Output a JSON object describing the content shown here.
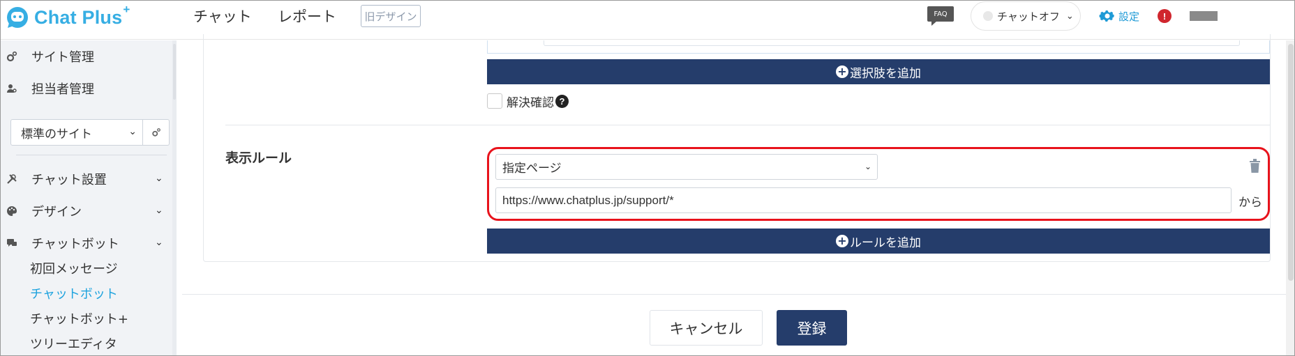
{
  "header": {
    "logo_text": "Chat Plus",
    "logo_plus": "+",
    "nav": {
      "chat": "チャット",
      "report": "レポート"
    },
    "old_design": "旧デザイン",
    "faq": "FAQ",
    "chat_status": "チャットオフ",
    "settings": "設定",
    "alert": "!"
  },
  "sidebar": {
    "items_top": [
      {
        "label": "サイト管理",
        "icon": "gears-icon"
      },
      {
        "label": "担当者管理",
        "icon": "users-icon"
      }
    ],
    "site_select": "標準のサイト",
    "items": [
      {
        "label": "チャット設置",
        "icon": "tools-icon"
      },
      {
        "label": "デザイン",
        "icon": "palette-icon"
      },
      {
        "label": "チャットボット",
        "icon": "chat-bubbles-icon"
      }
    ],
    "sub_items": [
      {
        "label": "初回メッセージ"
      },
      {
        "label": "チャットボット"
      },
      {
        "label": "チャットボット+"
      },
      {
        "label": "ツリーエディタ"
      }
    ]
  },
  "main": {
    "add_choice_button": "選択肢を追加",
    "resolve_check_label": "解決確認",
    "help_icon": "?",
    "rule_label": "表示ルール",
    "rule_select_value": "指定ページ",
    "url_value": "https://www.chatplus.jp/support/*",
    "from_label": "から",
    "add_rule_button": "ルールを追加",
    "cancel_button": "キャンセル",
    "save_button": "登録"
  },
  "colors": {
    "brand": "#36aee3",
    "navy": "#253d6b",
    "highlight": "#e8131c",
    "active_link": "#1fa3de"
  }
}
